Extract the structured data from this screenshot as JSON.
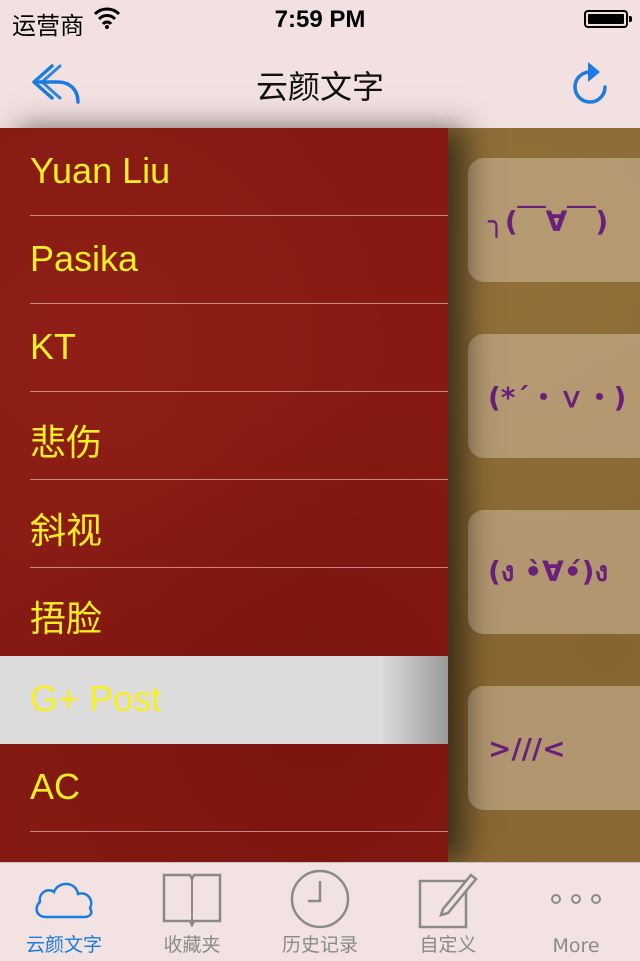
{
  "status_bar": {
    "carrier": "运营商",
    "time": "7:59 PM"
  },
  "nav": {
    "title": "云颜文字"
  },
  "menu": {
    "items": [
      {
        "label": "Yuan Liu"
      },
      {
        "label": "Pasika"
      },
      {
        "label": "KT"
      },
      {
        "label": "悲伤"
      },
      {
        "label": "斜视"
      },
      {
        "label": "捂脸"
      },
      {
        "label": "G+ Post",
        "selected": true
      },
      {
        "label": "AC"
      }
    ]
  },
  "emoticons": [
    {
      "text": "╮(￣∀￣)"
    },
    {
      "text": "(*´・ｖ・)"
    },
    {
      "text": "(ง •̀∀•́)ง"
    },
    {
      "text": ">///<"
    }
  ],
  "tabs": [
    {
      "label": "云颜文字",
      "icon": "cloud-icon",
      "active": true
    },
    {
      "label": "收藏夹",
      "icon": "book-icon"
    },
    {
      "label": "历史记录",
      "icon": "clock-icon"
    },
    {
      "label": "自定义",
      "icon": "edit-icon"
    },
    {
      "label": "More",
      "icon": "more-icon"
    }
  ],
  "colors": {
    "accent": "#1a7be0",
    "menu_bg": "#861a12",
    "menu_text": "#f7ef23",
    "emoticon_text": "#6a1f7a"
  }
}
